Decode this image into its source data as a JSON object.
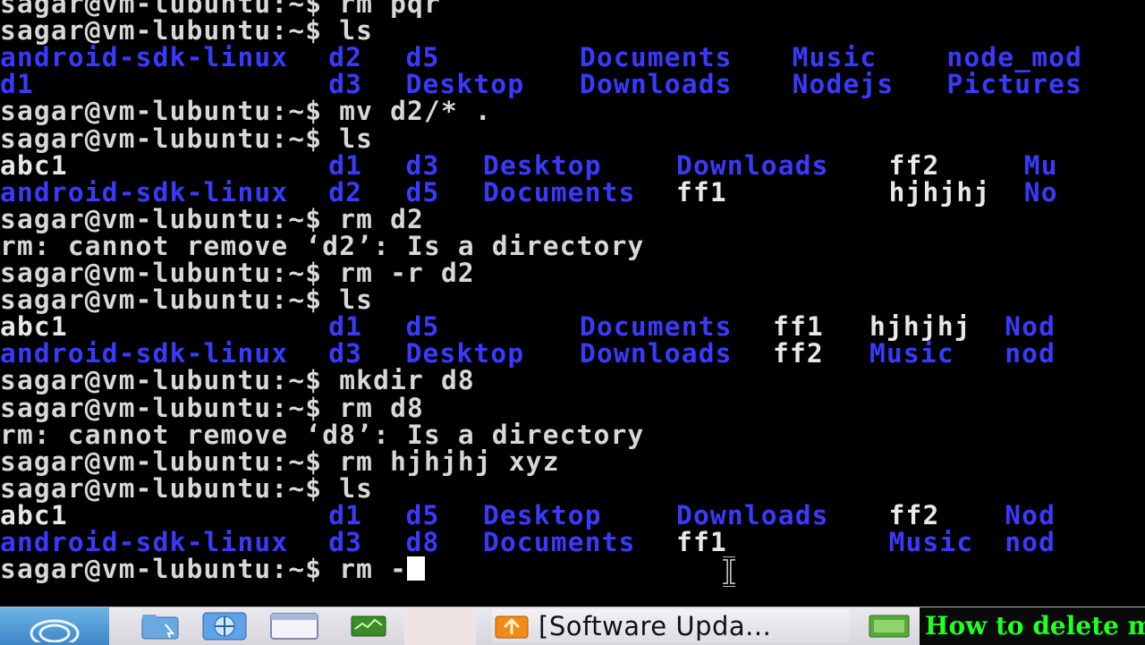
{
  "terminal": {
    "lines": [
      {
        "type": "cmd",
        "prompt": "sagar@vm-lubuntu:~$",
        "command": " rm pqr"
      },
      {
        "type": "cmd",
        "prompt": "sagar@vm-lubuntu:~$",
        "command": " ls"
      },
      {
        "type": "ls",
        "items": [
          {
            "text": "android-sdk-linux",
            "kind": "dir",
            "col": 0
          },
          {
            "text": "d2",
            "kind": "dir",
            "col": 17
          },
          {
            "text": "d5",
            "kind": "dir",
            "col": 21
          },
          {
            "text": "Documents",
            "kind": "dir",
            "col": 30
          },
          {
            "text": "Music",
            "kind": "dir",
            "col": 41
          },
          {
            "text": "node_mod",
            "kind": "dir",
            "col": 49
          }
        ]
      },
      {
        "type": "ls",
        "items": [
          {
            "text": "d1",
            "kind": "dir",
            "col": 0
          },
          {
            "text": "d3",
            "kind": "dir",
            "col": 17
          },
          {
            "text": "Desktop",
            "kind": "dir",
            "col": 21
          },
          {
            "text": "Downloads",
            "kind": "dir",
            "col": 30
          },
          {
            "text": "Nodejs",
            "kind": "dir",
            "col": 41
          },
          {
            "text": "Pictures",
            "kind": "dir",
            "col": 49
          }
        ]
      },
      {
        "type": "cmd",
        "prompt": "sagar@vm-lubuntu:~$",
        "command": " mv d2/* ."
      },
      {
        "type": "cmd",
        "prompt": "sagar@vm-lubuntu:~$",
        "command": " ls"
      },
      {
        "type": "ls",
        "items": [
          {
            "text": "abc1",
            "kind": "file",
            "col": 0
          },
          {
            "text": "d1",
            "kind": "dir",
            "col": 17
          },
          {
            "text": "d3",
            "kind": "dir",
            "col": 21
          },
          {
            "text": "Desktop",
            "kind": "dir",
            "col": 25
          },
          {
            "text": "Downloads",
            "kind": "dir",
            "col": 35
          },
          {
            "text": "ff2",
            "kind": "file",
            "col": 46
          },
          {
            "text": "Mu",
            "kind": "dir",
            "col": 53
          }
        ]
      },
      {
        "type": "ls",
        "items": [
          {
            "text": "android-sdk-linux",
            "kind": "dir",
            "col": 0
          },
          {
            "text": "d2",
            "kind": "dir",
            "col": 17
          },
          {
            "text": "d5",
            "kind": "dir",
            "col": 21
          },
          {
            "text": "Documents",
            "kind": "dir",
            "col": 25
          },
          {
            "text": "ff1",
            "kind": "file",
            "col": 35
          },
          {
            "text": "hjhjhj",
            "kind": "file",
            "col": 46
          },
          {
            "text": "No",
            "kind": "dir",
            "col": 53
          }
        ]
      },
      {
        "type": "cmd",
        "prompt": "sagar@vm-lubuntu:~$",
        "command": " rm d2"
      },
      {
        "type": "out",
        "text": "rm: cannot remove ‘d2’: Is a directory"
      },
      {
        "type": "cmd",
        "prompt": "sagar@vm-lubuntu:~$",
        "command": " rm -r d2"
      },
      {
        "type": "cmd",
        "prompt": "sagar@vm-lubuntu:~$",
        "command": " ls"
      },
      {
        "type": "ls",
        "items": [
          {
            "text": "abc1",
            "kind": "file",
            "col": 0
          },
          {
            "text": "d1",
            "kind": "dir",
            "col": 17
          },
          {
            "text": "d5",
            "kind": "dir",
            "col": 21
          },
          {
            "text": "Documents",
            "kind": "dir",
            "col": 30
          },
          {
            "text": "ff1",
            "kind": "file",
            "col": 40
          },
          {
            "text": "hjhjhj",
            "kind": "file",
            "col": 45
          },
          {
            "text": "Nod",
            "kind": "dir",
            "col": 52
          }
        ]
      },
      {
        "type": "ls",
        "items": [
          {
            "text": "android-sdk-linux",
            "kind": "dir",
            "col": 0
          },
          {
            "text": "d3",
            "kind": "dir",
            "col": 17
          },
          {
            "text": "Desktop",
            "kind": "dir",
            "col": 21
          },
          {
            "text": "Downloads",
            "kind": "dir",
            "col": 30
          },
          {
            "text": "ff2",
            "kind": "file",
            "col": 40
          },
          {
            "text": "Music",
            "kind": "dir",
            "col": 45
          },
          {
            "text": "nod",
            "kind": "dir",
            "col": 52
          }
        ]
      },
      {
        "type": "cmd",
        "prompt": "sagar@vm-lubuntu:~$",
        "command": " mkdir d8"
      },
      {
        "type": "cmd",
        "prompt": "sagar@vm-lubuntu:~$",
        "command": " rm d8"
      },
      {
        "type": "out",
        "text": "rm: cannot remove ‘d8’: Is a directory"
      },
      {
        "type": "cmd",
        "prompt": "sagar@vm-lubuntu:~$",
        "command": " rm hjhjhj xyz"
      },
      {
        "type": "cmd",
        "prompt": "sagar@vm-lubuntu:~$",
        "command": " ls"
      },
      {
        "type": "ls",
        "items": [
          {
            "text": "abc1",
            "kind": "file",
            "col": 0
          },
          {
            "text": "d1",
            "kind": "dir",
            "col": 17
          },
          {
            "text": "d5",
            "kind": "dir",
            "col": 21
          },
          {
            "text": "Desktop",
            "kind": "dir",
            "col": 25
          },
          {
            "text": "Downloads",
            "kind": "dir",
            "col": 35
          },
          {
            "text": "ff2",
            "kind": "file",
            "col": 46
          },
          {
            "text": "Nod",
            "kind": "dir",
            "col": 52
          }
        ]
      },
      {
        "type": "ls",
        "items": [
          {
            "text": "android-sdk-linux",
            "kind": "dir",
            "col": 0
          },
          {
            "text": "d3",
            "kind": "dir",
            "col": 17
          },
          {
            "text": "d8",
            "kind": "dir",
            "col": 21
          },
          {
            "text": "Documents",
            "kind": "dir",
            "col": 25
          },
          {
            "text": "ff1",
            "kind": "file",
            "col": 35
          },
          {
            "text": "Music",
            "kind": "dir",
            "col": 46
          },
          {
            "text": "nod",
            "kind": "dir",
            "col": 52
          }
        ]
      },
      {
        "type": "cmd",
        "prompt": "sagar@vm-lubuntu:~$",
        "command": " rm -",
        "cursor": true
      }
    ]
  },
  "taskbar": {
    "start_icon": "lubuntu-logo-icon",
    "launchers": [
      {
        "name": "file-manager-icon"
      },
      {
        "name": "web-browser-icon"
      },
      {
        "name": "terminal-icon"
      },
      {
        "name": "system-monitor-icon"
      }
    ],
    "tasks": [
      {
        "label": "[Software Upda...",
        "icon": "software-updater-icon"
      }
    ],
    "overlay_title": "How to delete mul"
  },
  "colors": {
    "terminal_bg": "#000000",
    "prompt_fg": "#d8d8d8",
    "dir_fg": "#3a3aff",
    "file_fg": "#e8e8e8",
    "overlay_title_fg": "#22ff22"
  }
}
